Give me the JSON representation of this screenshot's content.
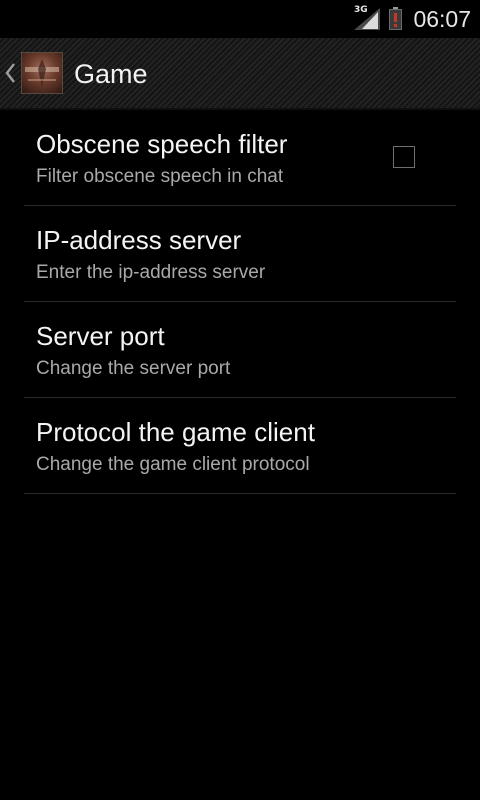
{
  "status_bar": {
    "network_type": "3G",
    "time": "06:07",
    "icons": [
      "signal-icon",
      "battery-icon"
    ]
  },
  "action_bar": {
    "title": "Game",
    "icons": [
      "back-chevron-icon",
      "app-icon"
    ]
  },
  "preferences": [
    {
      "title": "Obscene speech filter",
      "summary": "Filter obscene speech in chat",
      "has_checkbox": true,
      "checked": false
    },
    {
      "title": "IP-address server",
      "summary": "Enter the ip-address server",
      "has_checkbox": false
    },
    {
      "title": "Server port",
      "summary": "Change the server port",
      "has_checkbox": false
    },
    {
      "title": "Protocol the game client",
      "summary": "Change the game client protocol",
      "has_checkbox": false
    }
  ],
  "colors": {
    "background": "#000000",
    "action_bar": "#1b1b1b",
    "title_text": "#f4f4f4",
    "summary_text": "#a9a9a9",
    "divider": "#2a2a2a",
    "battery_warning": "#c0392b"
  }
}
